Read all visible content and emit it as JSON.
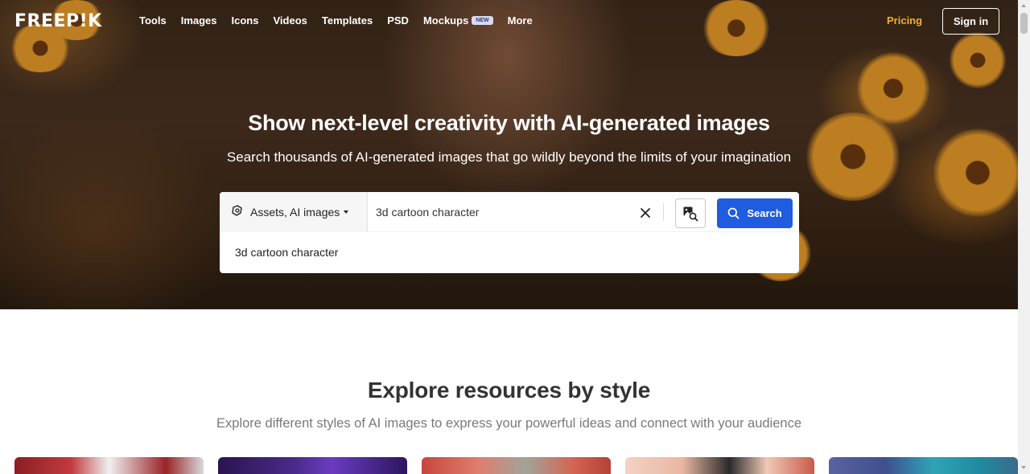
{
  "nav": {
    "logo": "FREEP!K",
    "links": [
      "Tools",
      "Images",
      "Icons",
      "Videos",
      "Templates",
      "PSD",
      "Mockups",
      "More"
    ],
    "mockups_badge": "NEW",
    "pricing": "Pricing",
    "sign_in": "Sign in"
  },
  "hero": {
    "title": "Show next-level creativity with AI-generated images",
    "subtitle": "Search thousands of AI-generated images that go wildly beyond the limits of your imagination"
  },
  "search": {
    "filter_label": "Assets, AI images",
    "query": "3d cartoon character",
    "search_button": "Search",
    "suggestions": [
      "3d cartoon character"
    ]
  },
  "explore": {
    "title": "Explore resources by style",
    "subtitle": "Explore different styles of AI images to express your powerful ideas and connect with your audience"
  },
  "colors": {
    "accent_blue": "#1f5ce0",
    "pricing_yellow": "#f7b02a"
  },
  "icons": [
    "ai-assets-icon",
    "caret-down-icon",
    "close-icon",
    "image-search-icon",
    "search-icon"
  ]
}
